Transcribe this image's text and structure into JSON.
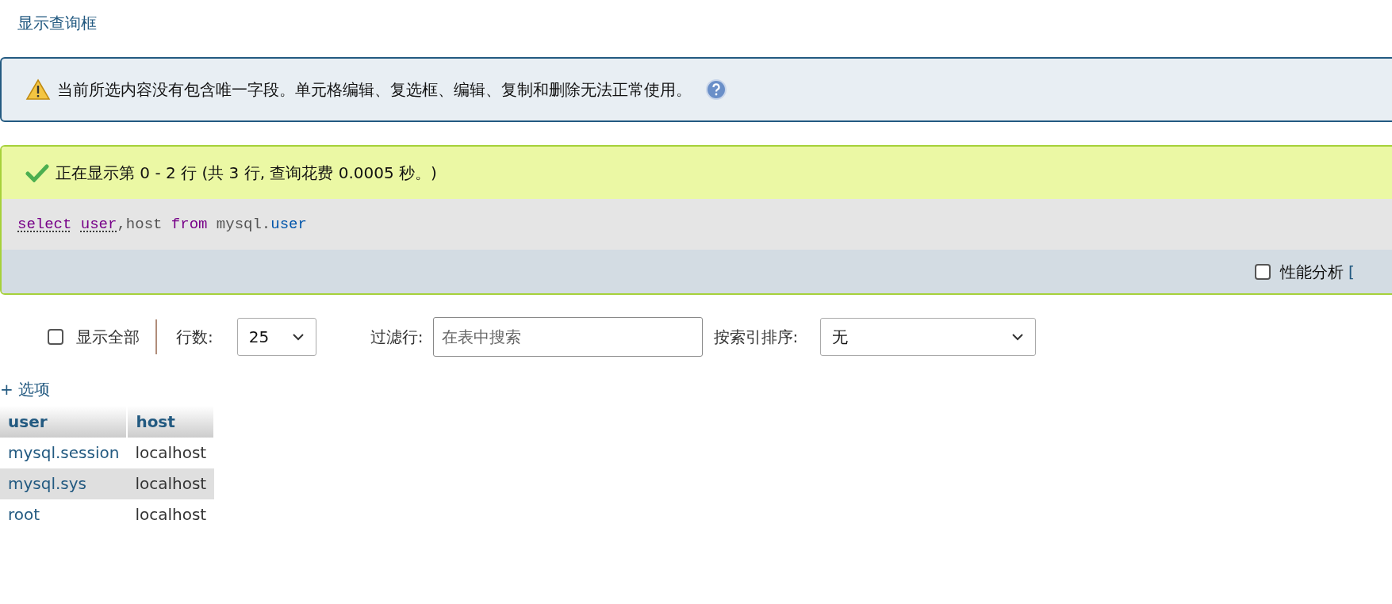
{
  "toggle_link": "显示查询框",
  "warning": {
    "text": "当前所选内容没有包含唯一字段。单元格编辑、复选框、编辑、复制和删除无法正常使用。"
  },
  "success": {
    "text": "正在显示第 0 - 2 行 (共 3 行, 查询花费 0.0005 秒。)"
  },
  "sql": [
    {
      "text": "select",
      "kind": "keyword"
    },
    {
      "text": "user",
      "kind": "keyword",
      "space_before": true
    },
    {
      "text": ",host ",
      "kind": "plain"
    },
    {
      "text": "from",
      "kind": "keyword2"
    },
    {
      "text": " mysql.",
      "kind": "plain"
    },
    {
      "text": "user",
      "kind": "name"
    }
  ],
  "profiling": {
    "label": "性能分析",
    "checked": false,
    "link": "["
  },
  "controls": {
    "show_all": {
      "label": "显示全部",
      "checked": false
    },
    "rows_label": "行数:",
    "rows_value": "25",
    "filter_label": "过滤行:",
    "filter_placeholder": "在表中搜索",
    "sort_label": "按索引排序:",
    "sort_value": "无"
  },
  "options_link": "+ 选项",
  "table": {
    "columns": [
      "user",
      "host"
    ],
    "rows": [
      {
        "cells": [
          "mysql.session",
          "localhost"
        ],
        "highlighted": false
      },
      {
        "cells": [
          "mysql.sys",
          "localhost"
        ],
        "highlighted": true
      },
      {
        "cells": [
          "root",
          "localhost"
        ],
        "highlighted": false
      }
    ]
  }
}
